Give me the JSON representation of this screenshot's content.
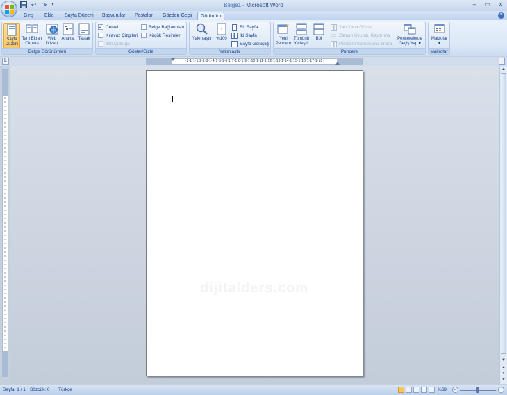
{
  "window": {
    "doc_name": "Belge1",
    "separator": " - ",
    "app_name": "Microsoft Word"
  },
  "tabs": [
    {
      "label": "Giriş"
    },
    {
      "label": "Ekle"
    },
    {
      "label": "Sayfa Düzeni"
    },
    {
      "label": "Başvurular"
    },
    {
      "label": "Postalar"
    },
    {
      "label": "Gözden Geçir"
    },
    {
      "label": "Görünüm",
      "active": true
    }
  ],
  "ribbon": {
    "belge_gorunumleri": {
      "label": "Belge Görünümleri",
      "sayfa_duzeni": [
        "Sayfa",
        "Düzeni"
      ],
      "tam_ekran": [
        "Tam Ekran",
        "Okuma"
      ],
      "web_duzeni": [
        "Web",
        "Düzeni"
      ],
      "anahat": "Anahat",
      "taslak": "Taslak"
    },
    "goster_gizle": {
      "label": "Göster/Gizle",
      "cetvel": "Cetvel",
      "kilavuz": "Kılavuz Çizgileri",
      "ileti": "İleti Çubuğu",
      "belge_baglantilari": "Belge Bağlantıları",
      "kucuk_resimler": "Küçük Resimler"
    },
    "yakinlastir": {
      "label": "Yakınlaştır",
      "yakinlastir_btn": "Yakınlaştır",
      "yuzde100": "%100",
      "bir_sayfa": "Bir Sayfa",
      "iki_sayfa": "İki Sayfa",
      "sayfa_genisligi": "Sayfa Genişliği"
    },
    "pencere": {
      "label": "Pencere",
      "yeni_pencere": [
        "Yeni",
        "Pencere"
      ],
      "tumunu_yerlestir": [
        "Tümünü",
        "Yerleştir"
      ],
      "bol": "Böl",
      "yan_yana": "Yan Yana Göster",
      "zaman_uyumlu": "Zaman Uyumlu Kaydırma",
      "konum_sifirla": "Pencere Konumunu Sıfırla",
      "gecis_yap": [
        "Pencerelerde",
        "Geçiş Yap ▾"
      ]
    },
    "makrolar": {
      "label": "Makrolar",
      "makrolar_btn": "Makrolar",
      "arrow": "▾"
    }
  },
  "ruler": {
    "marks": "·2·1·1·1·2·1·3·1·4·1·5·1·6·1·7·1·8·1·9·1·10·1·11·1·12·1·13·1·14·1·15·1·16·1·17·1·18·"
  },
  "document": {
    "watermark": "dijitalders.com"
  },
  "status": {
    "page": "Sayfa: 1 / 1",
    "words": "Sözcük: 0",
    "language": "Türkçe",
    "zoom": "%69",
    "zoom_fraction": 0.5
  }
}
